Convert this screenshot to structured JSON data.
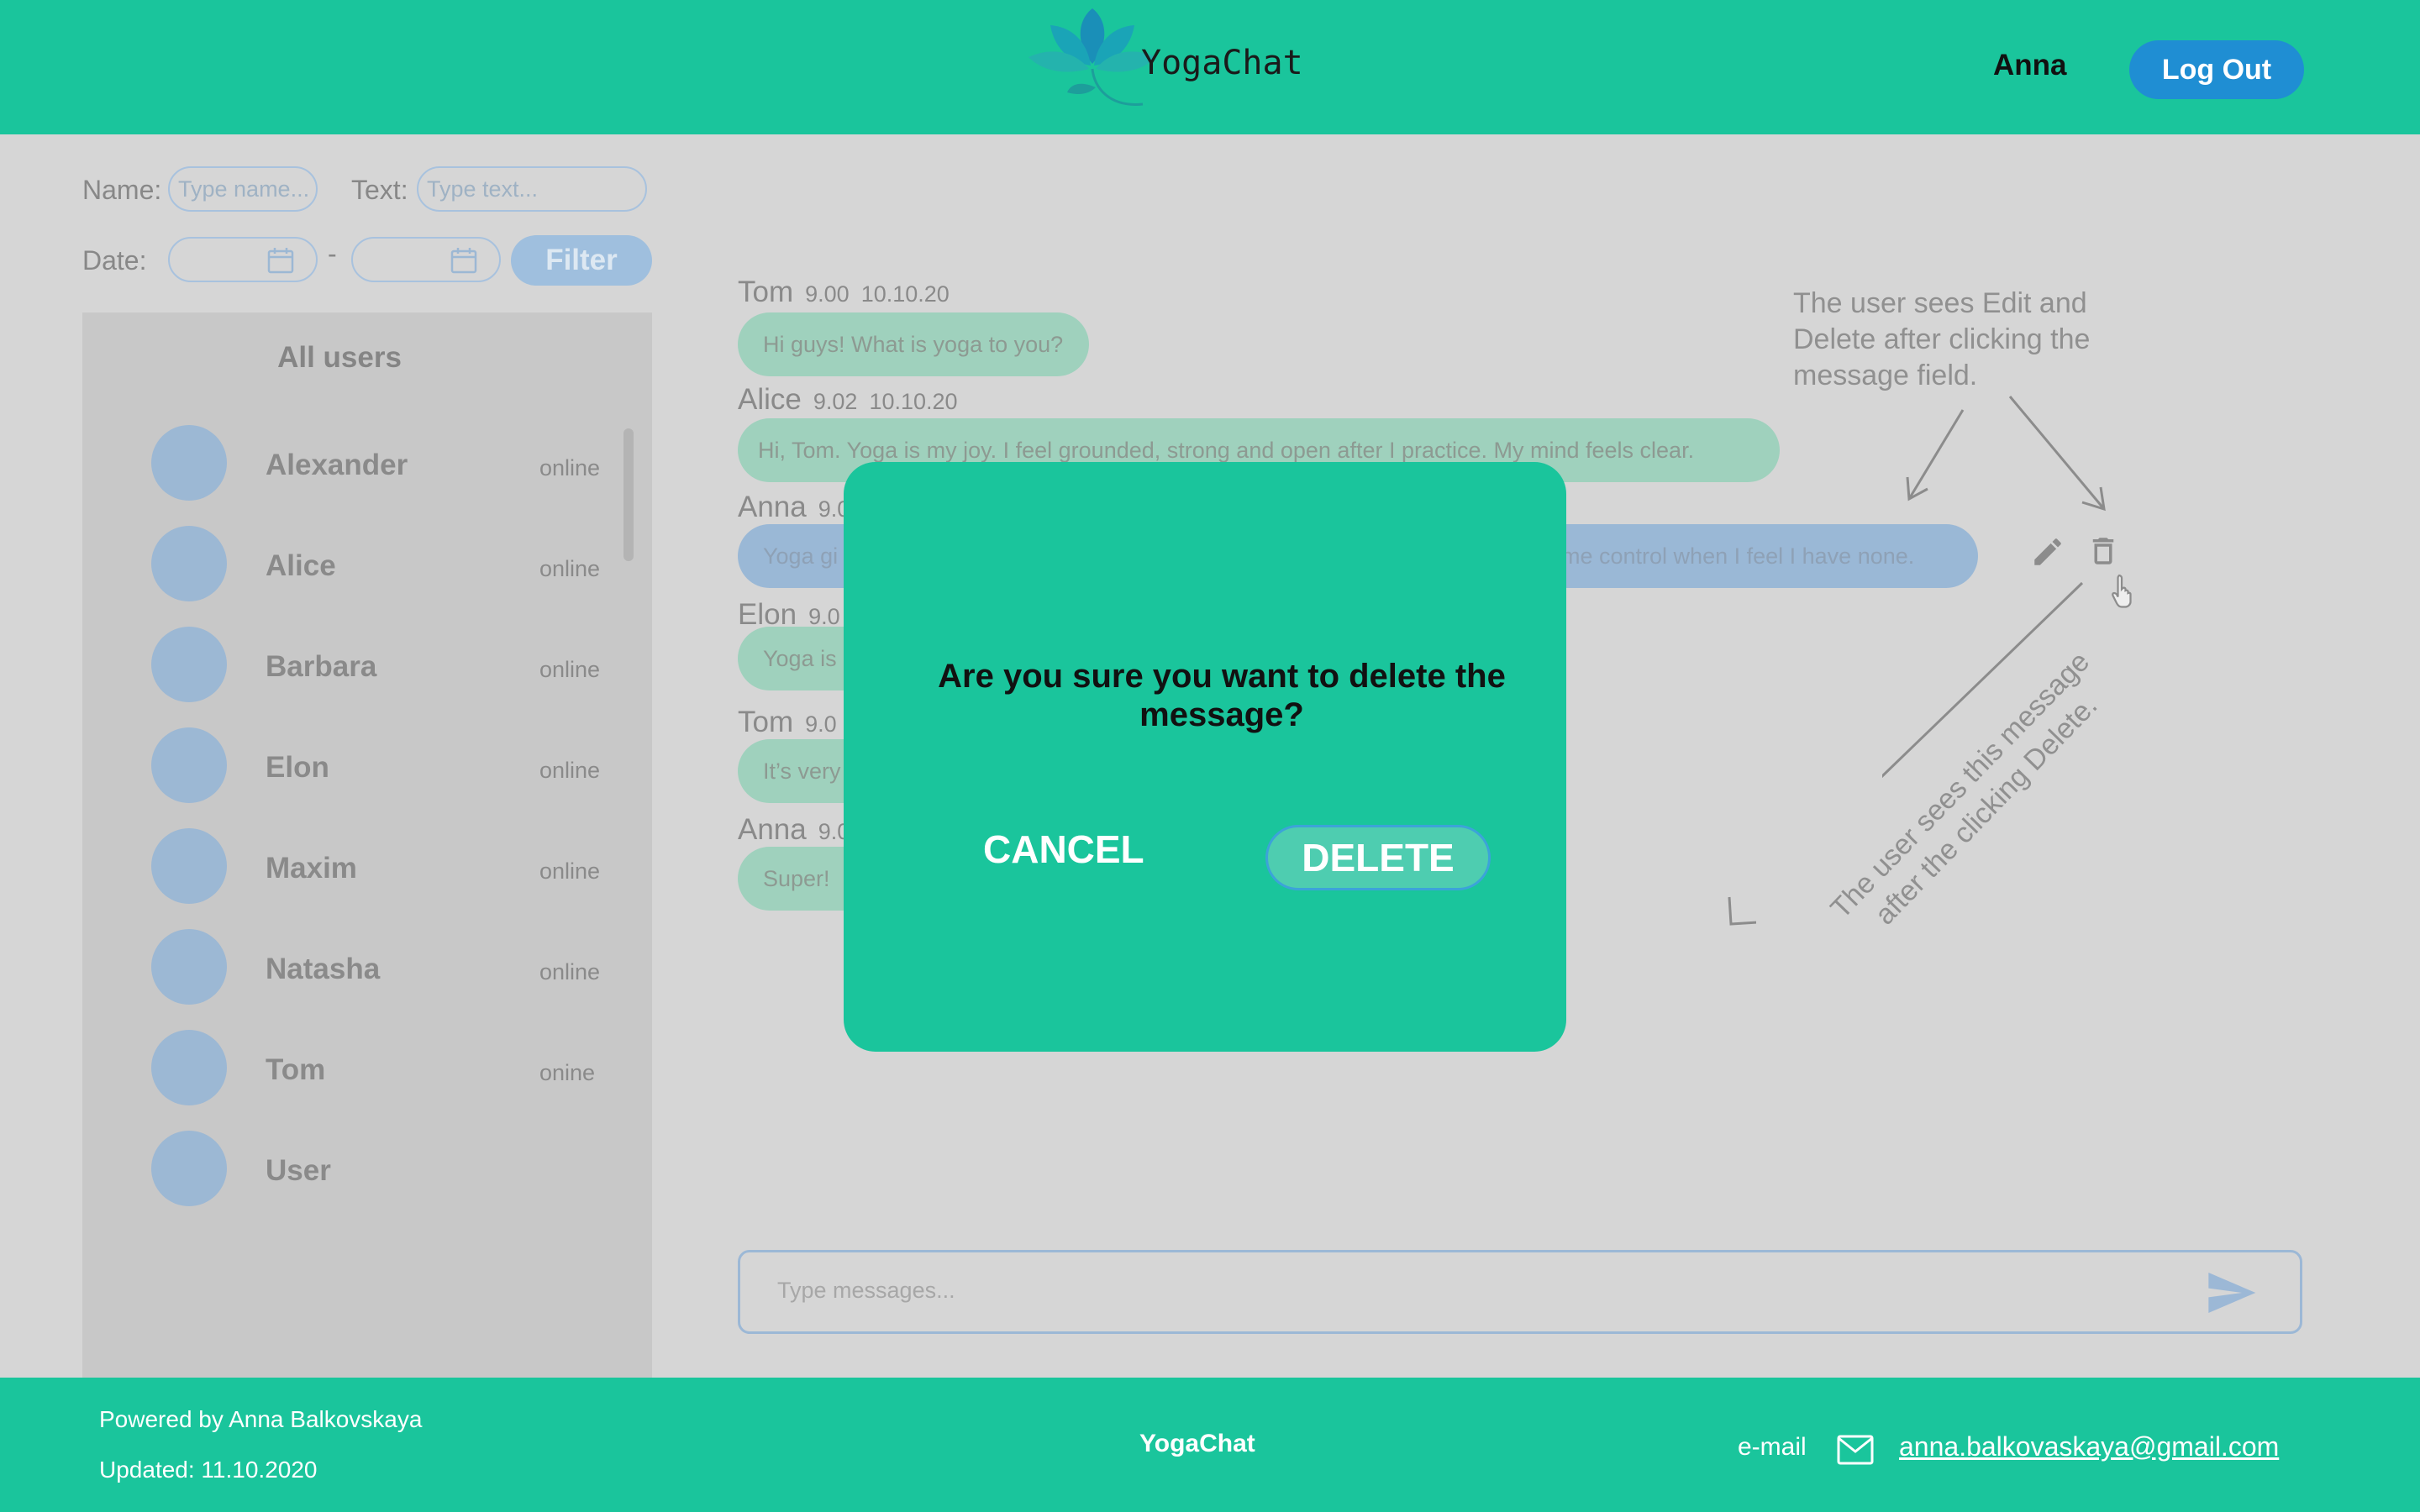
{
  "header": {
    "brand": "YogaChat",
    "username": "Anna",
    "logout_label": "Log Out"
  },
  "filters": {
    "name_label": "Name:",
    "name_placeholder": "Type name...",
    "text_label": "Text:",
    "text_placeholder": "Type text...",
    "date_label": "Date:",
    "date_separator": "-",
    "filter_label": "Filter"
  },
  "users_panel": {
    "title": "All users",
    "users": [
      {
        "name": "Alexander",
        "status": "online"
      },
      {
        "name": "Alice",
        "status": "online"
      },
      {
        "name": "Barbara",
        "status": "online"
      },
      {
        "name": "Elon",
        "status": "online"
      },
      {
        "name": "Maxim",
        "status": "online"
      },
      {
        "name": "Natasha",
        "status": "online"
      },
      {
        "name": "Tom",
        "status": "onine"
      },
      {
        "name": "User",
        "status": ""
      }
    ]
  },
  "messages": [
    {
      "author": "Tom",
      "time": "9.00",
      "date": "10.10.20",
      "text": "Hi guys! What is yoga to you?"
    },
    {
      "author": "Alice",
      "time": "9.02",
      "date": "10.10.20",
      "text": "Hi, Tom. Yoga is my joy. I feel grounded, strong and open after I practice. My mind feels clear."
    },
    {
      "author": "Anna",
      "time": "9.0",
      "date": "",
      "text": "Yoga gi",
      "text_tail": "me control when I feel I have none."
    },
    {
      "author": "Elon",
      "time": "9.0",
      "date": "",
      "text": "Yoga is"
    },
    {
      "author": "Tom",
      "time": "9.0",
      "date": "",
      "text": "It’s very"
    },
    {
      "author": "Anna",
      "time": "9.0",
      "date": "",
      "text": "Super!"
    }
  ],
  "annotations": {
    "edit_delete": "The user sees Edit and Delete after clicking the message field.",
    "confirm": "The user sees this message after the clicking Delete."
  },
  "composer": {
    "placeholder": "Type messages..."
  },
  "modal": {
    "question": "Are you sure you want to delete the message?",
    "cancel_label": "CANCEL",
    "delete_label": "DELETE"
  },
  "footer": {
    "powered": "Powered by Anna Balkovskaya",
    "updated": "Updated: 11.10.2020",
    "brand": "YogaChat",
    "email_label": "e-mail",
    "email": "anna.balkovaskaya@gmail.com"
  },
  "colors": {
    "accent": "#1ac59c",
    "button_blue": "#1f8ed3"
  },
  "icons": [
    "lotus-logo-icon",
    "calendar-icon",
    "edit-pencil-icon",
    "trash-icon",
    "pointer-hand-icon",
    "send-icon",
    "mail-icon"
  ]
}
